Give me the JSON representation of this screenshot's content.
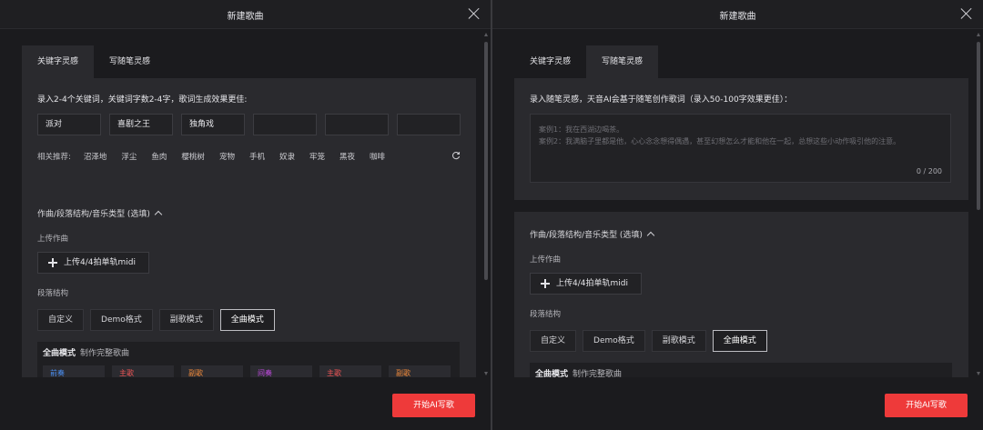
{
  "left": {
    "title": "新建歌曲",
    "tabs": [
      {
        "label": "关键字灵感",
        "active": true
      },
      {
        "label": "写随笔灵感",
        "active": false
      }
    ],
    "keyword_hint": "录入2-4个关键词，关键词字数2-4字，歌词生成效果更佳:",
    "keywords": [
      "派对",
      "喜剧之王",
      "独角戏",
      "",
      "",
      ""
    ],
    "recommend_label": "相关推荐:",
    "recommendations": [
      "沼泽地",
      "浮尘",
      "鱼肉",
      "樱桃树",
      "宠物",
      "手机",
      "奴隶",
      "牢笼",
      "黑夜",
      "咖啡"
    ],
    "options_title": "作曲/段落结构/音乐类型 (选填)",
    "upload_label": "上传作曲",
    "upload_button": "上传4/4拍单轨midi",
    "structure_label": "段落结构",
    "modes": [
      {
        "label": "自定义",
        "selected": false
      },
      {
        "label": "Demo格式",
        "selected": false
      },
      {
        "label": "副歌模式",
        "selected": false
      },
      {
        "label": "全曲模式",
        "selected": true
      }
    ],
    "mode_box_title": "全曲模式",
    "mode_box_desc": "制作完整歌曲",
    "mode_chips": [
      {
        "label": "前奏",
        "color": "#4a8ef0"
      },
      {
        "label": "主歌",
        "color": "#f05555"
      },
      {
        "label": "副歌",
        "color": "#f08a3a"
      },
      {
        "label": "间奏",
        "color": "#c04ae0"
      },
      {
        "label": "主歌",
        "color": "#f05555"
      },
      {
        "label": "副歌",
        "color": "#f08a3a"
      }
    ],
    "start_button": "开始AI写歌"
  },
  "right": {
    "title": "新建歌曲",
    "tabs": [
      {
        "label": "关键字灵感",
        "active": false
      },
      {
        "label": "写随笔灵感",
        "active": true
      }
    ],
    "essay_hint": "录入随笔灵感，天音AI会基于随笔创作歌词（录入50-100字效果更佳）：",
    "placeholder_line1": "案例1：我在西湖边喝茶。",
    "placeholder_line2": "案例2：我满脑子里都是他，心心念念想得偶遇，甚至幻想怎么才能和他在一起，总想这些小动作吸引他的注意。",
    "counter": "0 / 200",
    "options_title": "作曲/段落结构/音乐类型 (选填)",
    "upload_label": "上传作曲",
    "upload_button": "上传4/4拍单轨midi",
    "structure_label": "段落结构",
    "modes": [
      {
        "label": "自定义",
        "selected": false
      },
      {
        "label": "Demo格式",
        "selected": false
      },
      {
        "label": "副歌模式",
        "selected": false
      },
      {
        "label": "全曲模式",
        "selected": true
      }
    ],
    "mode_box_title": "全曲模式",
    "mode_box_desc": "制作完整歌曲",
    "start_button": "开始AI写歌"
  }
}
